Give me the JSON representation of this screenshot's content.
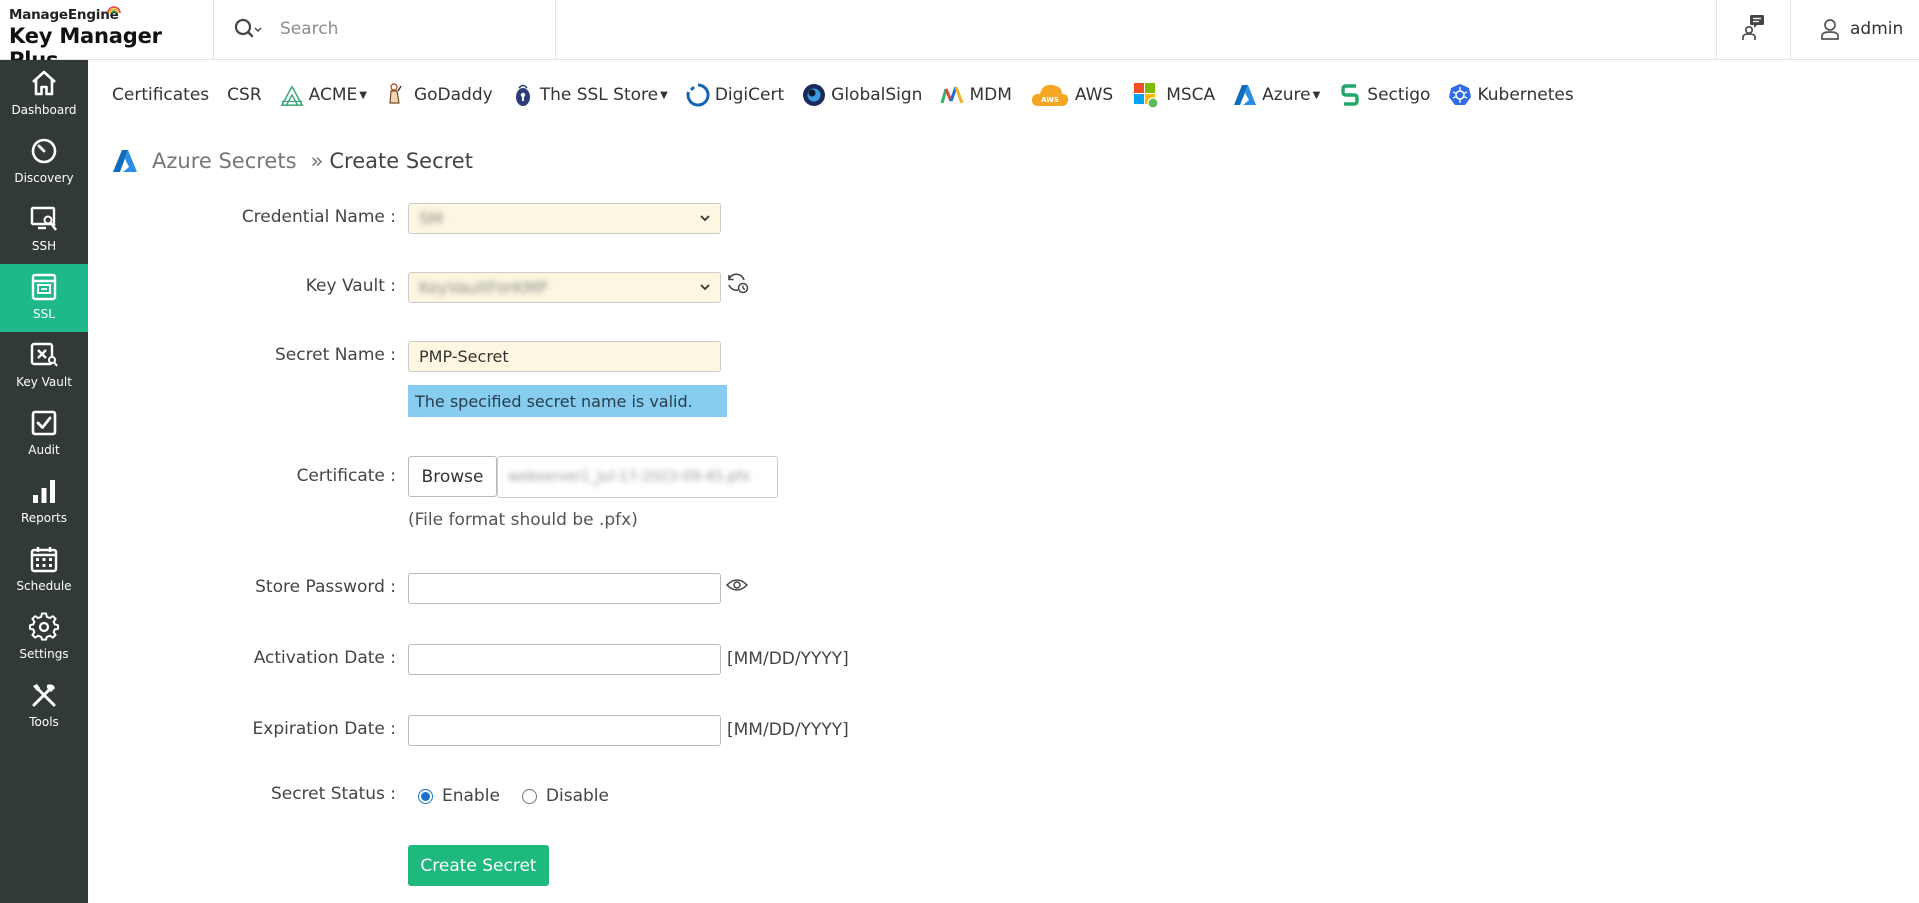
{
  "header": {
    "brand_top": "ManageEngine",
    "brand_product": "Key Manager Plus",
    "search_placeholder": "Search",
    "user": "admin"
  },
  "sidebar": {
    "items": [
      {
        "label": "Dashboard",
        "icon": "home-icon",
        "active": false
      },
      {
        "label": "Discovery",
        "icon": "discovery-icon",
        "active": false
      },
      {
        "label": "SSH",
        "icon": "ssh-icon",
        "active": false
      },
      {
        "label": "SSL",
        "icon": "ssl-icon",
        "active": true
      },
      {
        "label": "Key Vault",
        "icon": "key-vault-icon",
        "active": false
      },
      {
        "label": "Audit",
        "icon": "audit-icon",
        "active": false
      },
      {
        "label": "Reports",
        "icon": "reports-icon",
        "active": false
      },
      {
        "label": "Schedule",
        "icon": "calendar-icon",
        "active": false
      },
      {
        "label": "Settings",
        "icon": "gear-icon",
        "active": false
      },
      {
        "label": "Tools",
        "icon": "tools-icon",
        "active": false
      }
    ],
    "active_color": "#1eb98a",
    "background": "#323a37"
  },
  "tabs": [
    {
      "label": "Certificates"
    },
    {
      "label": "CSR"
    },
    {
      "label": "ACME",
      "dropdown": true
    },
    {
      "label": "GoDaddy"
    },
    {
      "label": "The SSL Store",
      "dropdown": true
    },
    {
      "label": "DigiCert"
    },
    {
      "label": "GlobalSign"
    },
    {
      "label": "MDM"
    },
    {
      "label": "AWS"
    },
    {
      "label": "MSCA"
    },
    {
      "label": "Azure",
      "dropdown": true
    },
    {
      "label": "Sectigo"
    },
    {
      "label": "Kubernetes"
    }
  ],
  "breadcrumb": {
    "parent": "Azure Secrets",
    "separator": "»",
    "current": "Create Secret"
  },
  "form": {
    "credential_name_label": "Credential Name :",
    "credential_name_value": "SM",
    "key_vault_label": "Key Vault :",
    "key_vault_value": "KeyVaultForKMP",
    "secret_name_label": "Secret Name :",
    "secret_name_value": "PMP-Secret",
    "secret_name_valid_msg": "The specified secret name is valid.",
    "certificate_label": "Certificate :",
    "browse_label": "Browse",
    "certificate_file": "webserver1_Jul-17-2023-09-45.pfx",
    "certificate_hint": "(File format should be .pfx)",
    "store_password_label": "Store Password :",
    "store_password_value": "",
    "activation_date_label": "Activation Date :",
    "activation_date_value": "",
    "expiration_date_label": "Expiration Date :",
    "expiration_date_value": "",
    "date_format": "[MM/DD/YYYY]",
    "secret_status_label": "Secret Status :",
    "status_enable": "Enable",
    "status_disable": "Disable",
    "status_selected": "Enable",
    "submit_label": "Create Secret"
  }
}
